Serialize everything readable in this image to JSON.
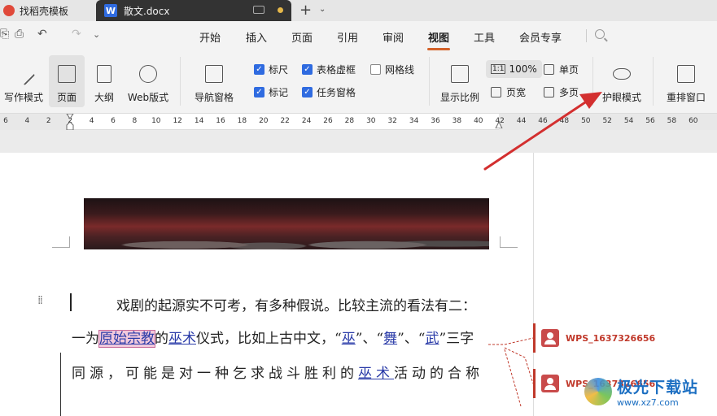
{
  "tabs": {
    "template_label": "找稻壳模板",
    "doc_label": "散文.docx",
    "new_tab": "+"
  },
  "menu": {
    "items": [
      "开始",
      "插入",
      "页面",
      "引用",
      "审阅",
      "视图",
      "工具",
      "会员专享"
    ],
    "active": "视图"
  },
  "ribbon": {
    "writing_mode": "写作模式",
    "page": "页面",
    "outline": "大纲",
    "web_layout": "Web版式",
    "nav_pane": "导航窗格",
    "ruler": "标尺",
    "table_gridlines": "表格虚框",
    "gridlines": "网格线",
    "markup": "标记",
    "task_pane": "任务窗格",
    "show_ratio": "显示比例",
    "zoom_100": "100%",
    "page_width": "页宽",
    "single_page": "单页",
    "multi_page": "多页",
    "eye_protection": "护眼模式",
    "rearrange_window": "重排窗口"
  },
  "checkbox_states": {
    "ruler": true,
    "table_gridlines": true,
    "gridlines": false,
    "markup": true,
    "task_pane": true
  },
  "ruler_ticks": [
    "6",
    "4",
    "2",
    "2",
    "4",
    "6",
    "8",
    "10",
    "12",
    "14",
    "16",
    "18",
    "20",
    "22",
    "24",
    "26",
    "28",
    "30",
    "32",
    "34",
    "36",
    "38",
    "40",
    "42",
    "44",
    "46",
    "48",
    "50",
    "52",
    "54",
    "56",
    "58",
    "60"
  ],
  "document": {
    "line1": "戏剧的起源实不可考，有多种假说。比较主流的看法有二：",
    "line2_a": "一为",
    "line2_b": "原始宗教",
    "line2_c": "的",
    "line2_d": "巫术",
    "line2_e": "仪式，比如上古中文，“",
    "line2_f": "巫",
    "line2_g": "”、“",
    "line2_h": "舞",
    "line2_i": "”、“",
    "line2_j": "武",
    "line2_k": "”三字",
    "line3_a": "同源，可能是对一种乞求战斗胜利的",
    "line3_b": "巫术",
    "line3_c": "活动的合称"
  },
  "comments": [
    {
      "author": "WPS_1637326656"
    },
    {
      "author": "WPS_1637326656"
    }
  ],
  "watermark": {
    "title": "极光下载站",
    "url": "www.xz7.com"
  },
  "colors": {
    "accent": "#d4622a",
    "checkbox": "#2f6be0",
    "revision": "#2a3ba8",
    "comment": "#c0392b",
    "arrow": "#d32f2f"
  }
}
